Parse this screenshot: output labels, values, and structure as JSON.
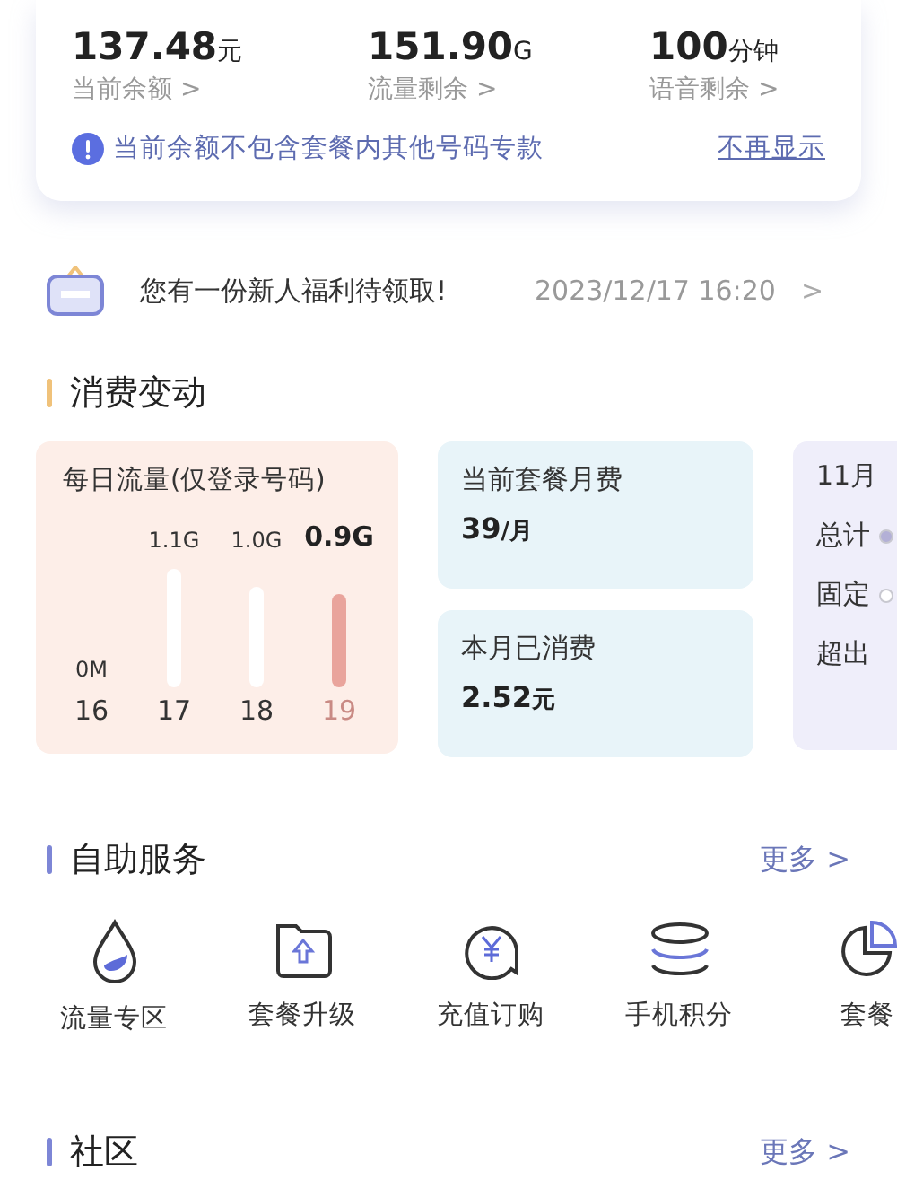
{
  "balance_card": {
    "stats": [
      {
        "value": "137.48",
        "unit": "元",
        "label": "当前余额 >"
      },
      {
        "value": "151.90",
        "unit": "G",
        "label": "流量剩余 >"
      },
      {
        "value": "100",
        "unit": "分钟",
        "label": "语音剩余 >"
      }
    ],
    "notice": {
      "text": "当前余额不包含套餐内其他号码专款",
      "dismiss": "不再显示"
    }
  },
  "message": {
    "text": "您有一份新人福利待领取!",
    "time": "2023/12/17 16:20",
    "chevron": ">"
  },
  "consumption": {
    "title": "消费变动",
    "daily_traffic": {
      "title": "每日流量(仅登录号码)",
      "days": [
        {
          "day": "16",
          "amount": "0M",
          "selected": false
        },
        {
          "day": "17",
          "amount": "1.1G",
          "selected": false
        },
        {
          "day": "18",
          "amount": "1.0G",
          "selected": false
        },
        {
          "day": "19",
          "amount": "0.9G",
          "selected": true
        }
      ]
    },
    "plan_fee": {
      "label": "当前套餐月费",
      "value": "39",
      "unit": "/月"
    },
    "month_spent": {
      "label": "本月已消费",
      "value": "2.52",
      "unit": "元"
    },
    "month_summary": {
      "title": "11月",
      "rows": [
        {
          "label": "总计",
          "color": "#b3b0d6"
        },
        {
          "label": "固定",
          "color": "#ffffff"
        },
        {
          "label": "超出"
        }
      ]
    }
  },
  "self_service": {
    "title": "自助服务",
    "more": "更多 >",
    "items": [
      {
        "label": "流量专区",
        "kind": "drop"
      },
      {
        "label": "套餐升级",
        "kind": "folder"
      },
      {
        "label": "充值订购",
        "kind": "recharge"
      },
      {
        "label": "手机积分",
        "kind": "coins"
      },
      {
        "label": "套餐",
        "kind": "pie"
      }
    ]
  },
  "community": {
    "title": "社区",
    "more": "更多 >"
  }
}
